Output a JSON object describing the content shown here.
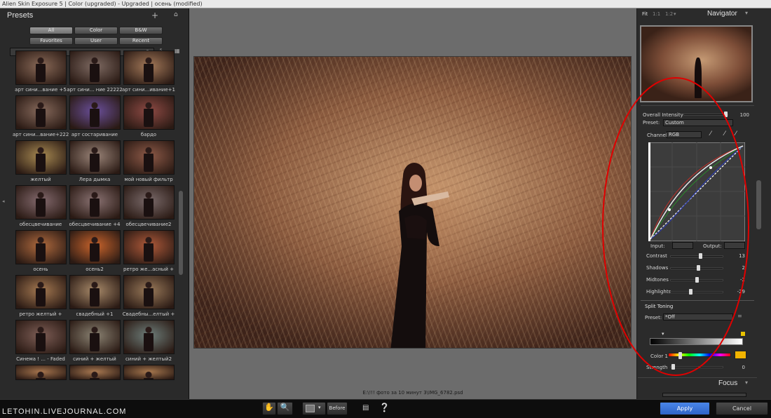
{
  "window": {
    "title": "Alien Skin Exposure 5 | Color (upgraded) - Upgraded | осень (modified)"
  },
  "presets": {
    "header": "Presets",
    "add_icon": "plus-icon",
    "home_icon": "home-icon",
    "filters": [
      "All",
      "Color",
      "B&W",
      "Favorites",
      "User",
      "Recent"
    ],
    "active_filter": "All",
    "search": {
      "placeholder": ""
    },
    "items": [
      {
        "label": "арт сини...вание +5",
        "tint": "#8a6a58"
      },
      {
        "label": "арт сини... ние 22222",
        "tint": "#7e6a62"
      },
      {
        "label": "арт сини...ивание+1",
        "tint": "#a57a5a"
      },
      {
        "label": "арт сини...вание+222",
        "tint": "#876a5c"
      },
      {
        "label": "арт состаривание",
        "tint": "#6a4f9a"
      },
      {
        "label": "бардо",
        "tint": "#8e4a44"
      },
      {
        "label": "желтый",
        "tint": "#a88a52"
      },
      {
        "label": "Лера дымка",
        "tint": "#9a8478"
      },
      {
        "label": "мой новый фильтр",
        "tint": "#8e5a48"
      },
      {
        "label": "обесцвечивание",
        "tint": "#846a6e"
      },
      {
        "label": "обесцвечивание +4",
        "tint": "#8a7272"
      },
      {
        "label": "обесцвечивание2",
        "tint": "#7a6a6a"
      },
      {
        "label": "осень",
        "tint": "#b06a3e"
      },
      {
        "label": "осень2",
        "tint": "#c9642c"
      },
      {
        "label": "ретро же...асный +",
        "tint": "#b05a3a"
      },
      {
        "label": "ретро желтый +",
        "tint": "#a67a52"
      },
      {
        "label": "свадебный +1",
        "tint": "#a88a6a"
      },
      {
        "label": "Свадебны...елтый +",
        "tint": "#9a7a5a"
      },
      {
        "label": "Синема ! ... - Faded",
        "tint": "#7e5e56"
      },
      {
        "label": "синий + желтый",
        "tint": "#8a8272"
      },
      {
        "label": "синий + желтый2",
        "tint": "#6e7e7a"
      },
      {
        "label": "",
        "tint": "#a8764e"
      },
      {
        "label": "",
        "tint": "#aa7a52"
      },
      {
        "label": "",
        "tint": "#a8784e"
      }
    ]
  },
  "canvas": {
    "filename": "E:\\!!! фото за 10 минут 3\\IMG_6782.psd"
  },
  "navigator": {
    "title": "Navigator",
    "zoom_fit": "Fit",
    "zoom_1_1": "1:1",
    "zoom_1_2": "1:2"
  },
  "overall": {
    "label": "Overall Intensity",
    "value": "100",
    "fraction": 0.95
  },
  "tone_curve": {
    "preset_label": "Preset:",
    "preset_value": "Custom",
    "channel_label": "Channel",
    "channel_value": "RGB",
    "input_label": "Input:",
    "output_label": "Output:",
    "sliders": [
      {
        "label": "Contrast",
        "value": "13",
        "fraction": 0.56
      },
      {
        "label": "Shadows",
        "value": "2",
        "fraction": 0.51
      },
      {
        "label": "Midtones",
        "value": "-2",
        "fraction": 0.49
      },
      {
        "label": "Highlights",
        "value": "-29",
        "fraction": 0.36
      }
    ]
  },
  "split_toning": {
    "title": "Split Toning",
    "preset_label": "Preset:",
    "preset_value": "*Off",
    "color1_label": "Color 1",
    "color1": "#f2b400",
    "strength_label": "Strength",
    "strength_value": "0",
    "strength_fraction": 0.02
  },
  "focus": {
    "title": "Focus"
  },
  "bottom": {
    "watermark": "LETOHIN.LIVEJOURNAL.COM",
    "before_label": "Before",
    "apply_label": "Apply",
    "cancel_label": "Cancel"
  },
  "colors": {
    "accent_apply": "#2f64c8",
    "annotation_ellipse": "#e00000"
  }
}
